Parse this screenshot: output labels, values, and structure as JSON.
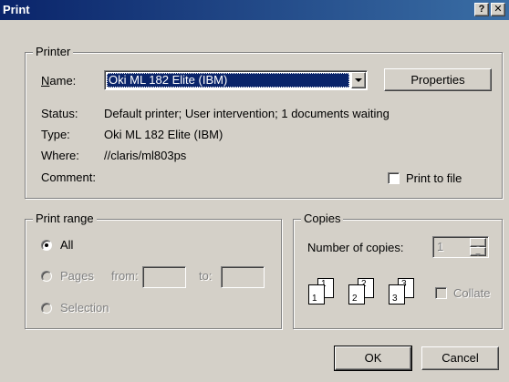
{
  "window": {
    "title": "Print",
    "help_label": "?",
    "close_label": "✕"
  },
  "printer": {
    "group_label": "Printer",
    "name_label": "Name:",
    "name_value": "Oki ML 182 Elite (IBM)",
    "properties_label": "Properties",
    "status_label": "Status:",
    "status_value": "Default printer; User intervention; 1 documents waiting",
    "type_label": "Type:",
    "type_value": "Oki ML 182 Elite (IBM)",
    "where_label": "Where:",
    "where_value": "//claris/ml803ps",
    "comment_label": "Comment:",
    "print_to_file_label": "Print to file"
  },
  "print_range": {
    "group_label": "Print range",
    "all_label": "All",
    "pages_label": "Pages",
    "from_label": "from:",
    "to_label": "to:",
    "from_value": "",
    "to_value": "",
    "selection_label": "Selection"
  },
  "copies": {
    "group_label": "Copies",
    "number_label": "Number of copies:",
    "number_value": "1",
    "collate_label": "Collate",
    "pages": [
      "1",
      "1",
      "2",
      "2",
      "3",
      "3"
    ]
  },
  "buttons": {
    "ok_label": "OK",
    "cancel_label": "Cancel"
  },
  "colors": {
    "face": "#d4d0c8",
    "title_start": "#0a246a",
    "title_end": "#3a6ea5",
    "selection": "#0a246a"
  }
}
